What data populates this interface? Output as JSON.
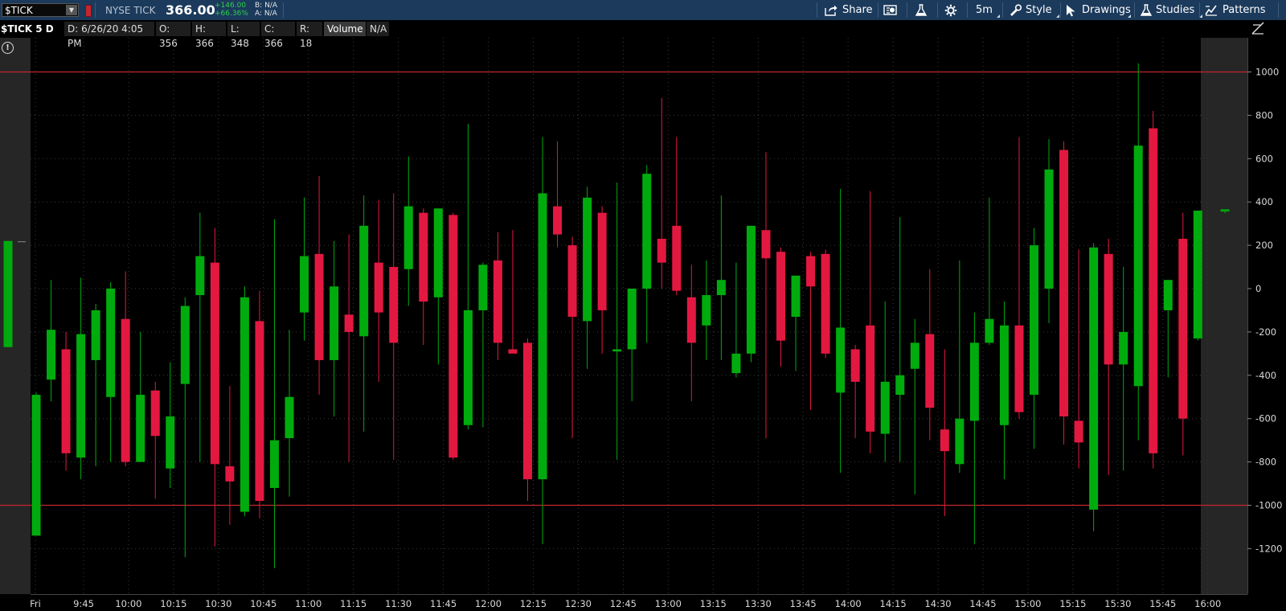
{
  "toolbar": {
    "symbol": "$TICK",
    "market_name": "NYSE TICK",
    "last_price": "366.00",
    "net_change": "+146.00",
    "pct_change": "+66.36%",
    "bid": "B: N/A",
    "ask": "A: N/A",
    "share_label": "Share",
    "timeframe_label": "5m",
    "style_label": "Style",
    "drawings_label": "Drawings",
    "studies_label": "Studies",
    "patterns_label": "Patterns"
  },
  "info_bar": {
    "title": "$TICK 5 D 5m",
    "date": "D: 6/26/20 4:05 PM",
    "open": "O: 356",
    "high": "H: 366",
    "low": "L: 348",
    "close": "C: 366",
    "range": "R: 18",
    "volume_label": "Volume",
    "volume_value": "N/A"
  },
  "colors": {
    "up": "#00ac0d",
    "down": "#e31841",
    "reference_line": "#c0282e",
    "grid": "#3a3a3a",
    "toolbar_bg": "#1b3a5c",
    "session_shade": "#262626"
  },
  "chart_data": {
    "type": "candlestick",
    "y_ticks": [
      1000,
      800,
      600,
      400,
      200,
      0,
      -200,
      -400,
      -600,
      -800,
      -1000,
      -1200
    ],
    "ylim": [
      -1350,
      1100
    ],
    "reference_lines": [
      1000,
      -1000
    ],
    "x_ticks": [
      "Fri",
      "9:45",
      "10:00",
      "10:15",
      "10:30",
      "10:45",
      "11:00",
      "11:15",
      "11:30",
      "11:45",
      "12:00",
      "12:15",
      "12:30",
      "12:45",
      "13:00",
      "13:15",
      "13:30",
      "13:45",
      "14:00",
      "14:15",
      "14:30",
      "14:45",
      "15:00",
      "15:15",
      "15:30",
      "15:45",
      "16:00"
    ],
    "premarket_candle": {
      "open": -270,
      "high": 220,
      "low": -270,
      "close": 220
    },
    "postmarket_candle": {
      "open": 356,
      "high": 366,
      "low": 348,
      "close": 366
    },
    "candles": [
      {
        "time": "9:30",
        "open": -1140,
        "high": -480,
        "low": -1140,
        "close": -490
      },
      {
        "time": "9:35",
        "open": -420,
        "high": 40,
        "low": -520,
        "close": -190
      },
      {
        "time": "9:40",
        "open": -280,
        "high": -200,
        "low": -840,
        "close": -760
      },
      {
        "time": "9:45",
        "open": -780,
        "high": 50,
        "low": -880,
        "close": -210
      },
      {
        "time": "9:50",
        "open": -330,
        "high": -70,
        "low": -820,
        "close": -100
      },
      {
        "time": "9:55",
        "open": -500,
        "high": 30,
        "low": -800,
        "close": 0
      },
      {
        "time": "10:00",
        "open": -140,
        "high": 80,
        "low": -820,
        "close": -800
      },
      {
        "time": "10:05",
        "open": -800,
        "high": -200,
        "low": -800,
        "close": -490
      },
      {
        "time": "10:10",
        "open": -470,
        "high": -430,
        "low": -970,
        "close": -680
      },
      {
        "time": "10:15",
        "open": -830,
        "high": -340,
        "low": -920,
        "close": -590
      },
      {
        "time": "10:20",
        "open": -440,
        "high": -40,
        "low": -1240,
        "close": -80
      },
      {
        "time": "10:25",
        "open": -30,
        "high": 350,
        "low": -800,
        "close": 150
      },
      {
        "time": "10:30",
        "open": 120,
        "high": 280,
        "low": -1190,
        "close": -810
      },
      {
        "time": "10:35",
        "open": -820,
        "high": -450,
        "low": -1090,
        "close": -890
      },
      {
        "time": "10:40",
        "open": -1030,
        "high": 10,
        "low": -1050,
        "close": -40
      },
      {
        "time": "10:45",
        "open": -150,
        "high": -10,
        "low": -1060,
        "close": -980
      },
      {
        "time": "10:50",
        "open": -920,
        "high": 320,
        "low": -1290,
        "close": -700
      },
      {
        "time": "10:55",
        "open": -690,
        "high": -190,
        "low": -960,
        "close": -500
      },
      {
        "time": "11:00",
        "open": -110,
        "high": 420,
        "low": -240,
        "close": 150
      },
      {
        "time": "11:05",
        "open": 160,
        "high": 520,
        "low": -490,
        "close": -330
      },
      {
        "time": "11:10",
        "open": -330,
        "high": 220,
        "low": -590,
        "close": 10
      },
      {
        "time": "11:15",
        "open": -120,
        "high": 250,
        "low": -800,
        "close": -200
      },
      {
        "time": "11:20",
        "open": -220,
        "high": 430,
        "low": -660,
        "close": 290
      },
      {
        "time": "11:25",
        "open": 120,
        "high": 410,
        "low": -430,
        "close": -110
      },
      {
        "time": "11:30",
        "open": 100,
        "high": 440,
        "low": -790,
        "close": -250
      },
      {
        "time": "11:35",
        "open": 90,
        "high": 610,
        "low": -80,
        "close": 380
      },
      {
        "time": "11:40",
        "open": 350,
        "high": 370,
        "low": -260,
        "close": -60
      },
      {
        "time": "11:45",
        "open": -40,
        "high": 370,
        "low": -350,
        "close": 370
      },
      {
        "time": "11:50",
        "open": 340,
        "high": 350,
        "low": -790,
        "close": -780
      },
      {
        "time": "11:55",
        "open": -630,
        "high": 760,
        "low": -650,
        "close": -100
      },
      {
        "time": "12:00",
        "open": -100,
        "high": 120,
        "low": -640,
        "close": 110
      },
      {
        "time": "12:05",
        "open": 130,
        "high": 260,
        "low": -330,
        "close": -250
      },
      {
        "time": "12:10",
        "open": -280,
        "high": 270,
        "low": -290,
        "close": -300
      },
      {
        "time": "12:15",
        "open": -250,
        "high": -230,
        "low": -980,
        "close": -880
      },
      {
        "time": "12:20",
        "open": -880,
        "high": 700,
        "low": -1180,
        "close": 440
      },
      {
        "time": "12:25",
        "open": 380,
        "high": 680,
        "low": 190,
        "close": 250
      },
      {
        "time": "12:30",
        "open": 200,
        "high": 240,
        "low": -690,
        "close": -130
      },
      {
        "time": "12:35",
        "open": -150,
        "high": 470,
        "low": -370,
        "close": 420
      },
      {
        "time": "12:40",
        "open": 350,
        "high": 380,
        "low": -300,
        "close": -100
      },
      {
        "time": "12:45",
        "open": -290,
        "high": 490,
        "low": -790,
        "close": -280
      },
      {
        "time": "12:50",
        "open": -280,
        "high": 0,
        "low": -520,
        "close": 0
      },
      {
        "time": "12:55",
        "open": 0,
        "high": 570,
        "low": -250,
        "close": 530
      },
      {
        "time": "13:00",
        "open": 230,
        "high": 880,
        "low": 0,
        "close": 120
      },
      {
        "time": "13:05",
        "open": 290,
        "high": 700,
        "low": -30,
        "close": -10
      },
      {
        "time": "13:10",
        "open": -40,
        "high": 110,
        "low": -520,
        "close": -250
      },
      {
        "time": "13:15",
        "open": -170,
        "high": 130,
        "low": -330,
        "close": -30
      },
      {
        "time": "13:20",
        "open": -30,
        "high": 430,
        "low": -330,
        "close": 40
      },
      {
        "time": "13:25",
        "open": -390,
        "high": 120,
        "low": -410,
        "close": -300
      },
      {
        "time": "13:30",
        "open": -300,
        "high": 290,
        "low": -340,
        "close": 290
      },
      {
        "time": "13:35",
        "open": 270,
        "high": 630,
        "low": -690,
        "close": 140
      },
      {
        "time": "13:40",
        "open": 170,
        "high": 190,
        "low": -360,
        "close": -240
      },
      {
        "time": "13:45",
        "open": -130,
        "high": 50,
        "low": -380,
        "close": 60
      },
      {
        "time": "13:50",
        "open": 150,
        "high": 170,
        "low": -560,
        "close": 10
      },
      {
        "time": "13:55",
        "open": 160,
        "high": 180,
        "low": -320,
        "close": -300
      },
      {
        "time": "14:00",
        "open": -480,
        "high": 460,
        "low": -850,
        "close": -180
      },
      {
        "time": "14:05",
        "open": -280,
        "high": -260,
        "low": -690,
        "close": -430
      },
      {
        "time": "14:10",
        "open": -170,
        "high": 450,
        "low": -760,
        "close": -660
      },
      {
        "time": "14:15",
        "open": -670,
        "high": -60,
        "low": -800,
        "close": -430
      },
      {
        "time": "14:20",
        "open": -490,
        "high": 330,
        "low": -800,
        "close": -400
      },
      {
        "time": "14:25",
        "open": -370,
        "high": -140,
        "low": -950,
        "close": -250
      },
      {
        "time": "14:30",
        "open": -210,
        "high": 90,
        "low": -700,
        "close": -550
      },
      {
        "time": "14:35",
        "open": -650,
        "high": -280,
        "low": -1050,
        "close": -750
      },
      {
        "time": "14:40",
        "open": -810,
        "high": 130,
        "low": -850,
        "close": -600
      },
      {
        "time": "14:45",
        "open": -610,
        "high": -110,
        "low": -1180,
        "close": -250
      },
      {
        "time": "14:50",
        "open": -250,
        "high": 420,
        "low": -260,
        "close": -140
      },
      {
        "time": "14:55",
        "open": -630,
        "high": -60,
        "low": -880,
        "close": -170
      },
      {
        "time": "15:00",
        "open": -170,
        "high": 700,
        "low": -600,
        "close": -570
      },
      {
        "time": "15:05",
        "open": -490,
        "high": 280,
        "low": -740,
        "close": 200
      },
      {
        "time": "15:10",
        "open": 0,
        "high": 690,
        "low": -160,
        "close": 550
      },
      {
        "time": "15:15",
        "open": 640,
        "high": 680,
        "low": -720,
        "close": -590
      },
      {
        "time": "15:20",
        "open": -610,
        "high": 180,
        "low": -830,
        "close": -710
      },
      {
        "time": "15:25",
        "open": -1020,
        "high": 210,
        "low": -1120,
        "close": 190
      },
      {
        "time": "15:30",
        "open": 160,
        "high": 230,
        "low": -860,
        "close": -350
      },
      {
        "time": "15:35",
        "open": -350,
        "high": 100,
        "low": -840,
        "close": -200
      },
      {
        "time": "15:40",
        "open": -450,
        "high": 1040,
        "low": -700,
        "close": 660
      },
      {
        "time": "15:45",
        "open": 740,
        "high": 820,
        "low": -830,
        "close": -760
      },
      {
        "time": "15:50",
        "open": -100,
        "high": 40,
        "low": -410,
        "close": 40
      },
      {
        "time": "15:55",
        "open": 230,
        "high": 350,
        "low": -770,
        "close": -600
      },
      {
        "time": "16:00",
        "open": -230,
        "high": 360,
        "low": -240,
        "close": 360
      }
    ]
  }
}
